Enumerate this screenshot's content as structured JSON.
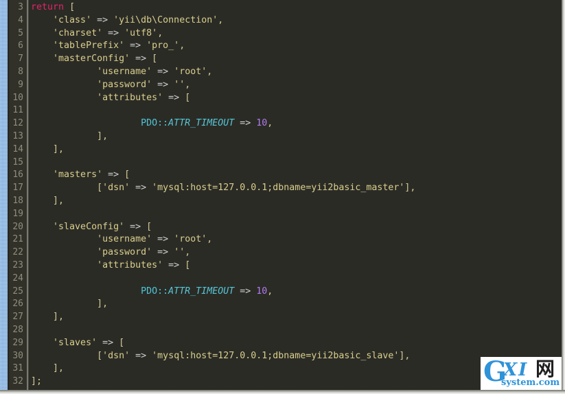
{
  "editor": {
    "theme_name": "dark-monokai",
    "background_color": "#2b2b26",
    "gutter_color": "#313129",
    "marker_rail_color": "#7fb3ea",
    "line_number_color": "#8e8e7e",
    "first_line_number": 3,
    "last_line_number": 32,
    "language": "php"
  },
  "colors": {
    "keyword": "#e2246a",
    "string": "#d9cf8c",
    "operator": "#cfcfcf",
    "class_name": "#4ec6d6",
    "constant": "#55c7d6",
    "number": "#b07cf0",
    "punctuation": "#d4cb96"
  },
  "line_numbers": [
    3,
    4,
    5,
    6,
    7,
    8,
    9,
    10,
    11,
    12,
    13,
    14,
    15,
    16,
    17,
    18,
    19,
    20,
    21,
    22,
    23,
    24,
    25,
    26,
    27,
    28,
    29,
    30,
    31,
    32
  ],
  "code_lines": [
    {
      "number": 3,
      "text": "return [",
      "tokens": [
        {
          "t": "return",
          "c": "t-kw"
        },
        {
          "t": " ",
          "c": "t-plain"
        },
        {
          "t": "[",
          "c": "t-punct"
        }
      ]
    },
    {
      "number": 4,
      "text": "    'class' => 'yii\\db\\Connection',",
      "tokens": [
        {
          "t": "    ",
          "c": "t-plain"
        },
        {
          "t": "'class'",
          "c": "t-str"
        },
        {
          "t": " ",
          "c": "t-plain"
        },
        {
          "t": "=>",
          "c": "t-op"
        },
        {
          "t": " ",
          "c": "t-plain"
        },
        {
          "t": "'yii\\db\\Connection'",
          "c": "t-str"
        },
        {
          "t": ",",
          "c": "t-punct"
        }
      ]
    },
    {
      "number": 5,
      "text": "    'charset' => 'utf8',",
      "tokens": [
        {
          "t": "    ",
          "c": "t-plain"
        },
        {
          "t": "'charset'",
          "c": "t-str"
        },
        {
          "t": " ",
          "c": "t-plain"
        },
        {
          "t": "=>",
          "c": "t-op"
        },
        {
          "t": " ",
          "c": "t-plain"
        },
        {
          "t": "'utf8'",
          "c": "t-str"
        },
        {
          "t": ",",
          "c": "t-punct"
        }
      ]
    },
    {
      "number": 6,
      "text": "    'tablePrefix' => 'pro_',",
      "tokens": [
        {
          "t": "    ",
          "c": "t-plain"
        },
        {
          "t": "'tablePrefix'",
          "c": "t-str"
        },
        {
          "t": " ",
          "c": "t-plain"
        },
        {
          "t": "=>",
          "c": "t-op"
        },
        {
          "t": " ",
          "c": "t-plain"
        },
        {
          "t": "'pro_'",
          "c": "t-str"
        },
        {
          "t": ",",
          "c": "t-punct"
        }
      ]
    },
    {
      "number": 7,
      "text": "    'masterConfig' => [",
      "tokens": [
        {
          "t": "    ",
          "c": "t-plain"
        },
        {
          "t": "'masterConfig'",
          "c": "t-str"
        },
        {
          "t": " ",
          "c": "t-plain"
        },
        {
          "t": "=>",
          "c": "t-op"
        },
        {
          "t": " ",
          "c": "t-plain"
        },
        {
          "t": "[",
          "c": "t-punct"
        }
      ]
    },
    {
      "number": 8,
      "text": "            'username' => 'root',",
      "tokens": [
        {
          "t": "            ",
          "c": "t-plain"
        },
        {
          "t": "'username'",
          "c": "t-str"
        },
        {
          "t": " ",
          "c": "t-plain"
        },
        {
          "t": "=>",
          "c": "t-op"
        },
        {
          "t": " ",
          "c": "t-plain"
        },
        {
          "t": "'root'",
          "c": "t-str"
        },
        {
          "t": ",",
          "c": "t-punct"
        }
      ]
    },
    {
      "number": 9,
      "text": "            'password' => '',",
      "tokens": [
        {
          "t": "            ",
          "c": "t-plain"
        },
        {
          "t": "'password'",
          "c": "t-str"
        },
        {
          "t": " ",
          "c": "t-plain"
        },
        {
          "t": "=>",
          "c": "t-op"
        },
        {
          "t": " ",
          "c": "t-plain"
        },
        {
          "t": "''",
          "c": "t-str"
        },
        {
          "t": ",",
          "c": "t-punct"
        }
      ]
    },
    {
      "number": 10,
      "text": "            'attributes' => [",
      "tokens": [
        {
          "t": "            ",
          "c": "t-plain"
        },
        {
          "t": "'attributes'",
          "c": "t-str"
        },
        {
          "t": " ",
          "c": "t-plain"
        },
        {
          "t": "=>",
          "c": "t-op"
        },
        {
          "t": " ",
          "c": "t-plain"
        },
        {
          "t": "[",
          "c": "t-punct"
        }
      ]
    },
    {
      "number": 11,
      "text": "",
      "tokens": []
    },
    {
      "number": 12,
      "text": "                    PDO::ATTR_TIMEOUT => 10,",
      "tokens": [
        {
          "t": "                    ",
          "c": "t-plain"
        },
        {
          "t": "PDO",
          "c": "t-class"
        },
        {
          "t": "::",
          "c": "t-class"
        },
        {
          "t": "ATTR_TIMEOUT",
          "c": "t-const"
        },
        {
          "t": " ",
          "c": "t-plain"
        },
        {
          "t": "=>",
          "c": "t-op"
        },
        {
          "t": " ",
          "c": "t-plain"
        },
        {
          "t": "10",
          "c": "t-num"
        },
        {
          "t": ",",
          "c": "t-punct"
        }
      ]
    },
    {
      "number": 13,
      "text": "            ],",
      "tokens": [
        {
          "t": "            ",
          "c": "t-plain"
        },
        {
          "t": "],",
          "c": "t-punct"
        }
      ]
    },
    {
      "number": 14,
      "text": "    ],",
      "tokens": [
        {
          "t": "    ",
          "c": "t-plain"
        },
        {
          "t": "],",
          "c": "t-punct"
        }
      ]
    },
    {
      "number": 15,
      "text": "",
      "tokens": []
    },
    {
      "number": 16,
      "text": "    'masters' => [",
      "tokens": [
        {
          "t": "    ",
          "c": "t-plain"
        },
        {
          "t": "'masters'",
          "c": "t-str"
        },
        {
          "t": " ",
          "c": "t-plain"
        },
        {
          "t": "=>",
          "c": "t-op"
        },
        {
          "t": " ",
          "c": "t-plain"
        },
        {
          "t": "[",
          "c": "t-punct"
        }
      ]
    },
    {
      "number": 17,
      "text": "            ['dsn' => 'mysql:host=127.0.0.1;dbname=yii2basic_master'],",
      "tokens": [
        {
          "t": "            ",
          "c": "t-plain"
        },
        {
          "t": "[",
          "c": "t-punct"
        },
        {
          "t": "'dsn'",
          "c": "t-str"
        },
        {
          "t": " ",
          "c": "t-plain"
        },
        {
          "t": "=>",
          "c": "t-op"
        },
        {
          "t": " ",
          "c": "t-plain"
        },
        {
          "t": "'mysql:host=127.0.0.1;dbname=yii2basic_master'",
          "c": "t-str"
        },
        {
          "t": "],",
          "c": "t-punct"
        }
      ]
    },
    {
      "number": 18,
      "text": "    ],",
      "tokens": [
        {
          "t": "    ",
          "c": "t-plain"
        },
        {
          "t": "],",
          "c": "t-punct"
        }
      ]
    },
    {
      "number": 19,
      "text": "",
      "tokens": []
    },
    {
      "number": 20,
      "text": "    'slaveConfig' => [",
      "tokens": [
        {
          "t": "    ",
          "c": "t-plain"
        },
        {
          "t": "'slaveConfig'",
          "c": "t-str"
        },
        {
          "t": " ",
          "c": "t-plain"
        },
        {
          "t": "=>",
          "c": "t-op"
        },
        {
          "t": " ",
          "c": "t-plain"
        },
        {
          "t": "[",
          "c": "t-punct"
        }
      ]
    },
    {
      "number": 21,
      "text": "            'username' => 'root',",
      "tokens": [
        {
          "t": "            ",
          "c": "t-plain"
        },
        {
          "t": "'username'",
          "c": "t-str"
        },
        {
          "t": " ",
          "c": "t-plain"
        },
        {
          "t": "=>",
          "c": "t-op"
        },
        {
          "t": " ",
          "c": "t-plain"
        },
        {
          "t": "'root'",
          "c": "t-str"
        },
        {
          "t": ",",
          "c": "t-punct"
        }
      ]
    },
    {
      "number": 22,
      "text": "            'password' => '',",
      "tokens": [
        {
          "t": "            ",
          "c": "t-plain"
        },
        {
          "t": "'password'",
          "c": "t-str"
        },
        {
          "t": " ",
          "c": "t-plain"
        },
        {
          "t": "=>",
          "c": "t-op"
        },
        {
          "t": " ",
          "c": "t-plain"
        },
        {
          "t": "''",
          "c": "t-str"
        },
        {
          "t": ",",
          "c": "t-punct"
        }
      ]
    },
    {
      "number": 23,
      "text": "            'attributes' => [",
      "tokens": [
        {
          "t": "            ",
          "c": "t-plain"
        },
        {
          "t": "'attributes'",
          "c": "t-str"
        },
        {
          "t": " ",
          "c": "t-plain"
        },
        {
          "t": "=>",
          "c": "t-op"
        },
        {
          "t": " ",
          "c": "t-plain"
        },
        {
          "t": "[",
          "c": "t-punct"
        }
      ]
    },
    {
      "number": 24,
      "text": "",
      "tokens": []
    },
    {
      "number": 25,
      "text": "                    PDO::ATTR_TIMEOUT => 10,",
      "tokens": [
        {
          "t": "                    ",
          "c": "t-plain"
        },
        {
          "t": "PDO",
          "c": "t-class"
        },
        {
          "t": "::",
          "c": "t-class"
        },
        {
          "t": "ATTR_TIMEOUT",
          "c": "t-const"
        },
        {
          "t": " ",
          "c": "t-plain"
        },
        {
          "t": "=>",
          "c": "t-op"
        },
        {
          "t": " ",
          "c": "t-plain"
        },
        {
          "t": "10",
          "c": "t-num"
        },
        {
          "t": ",",
          "c": "t-punct"
        }
      ]
    },
    {
      "number": 26,
      "text": "            ],",
      "tokens": [
        {
          "t": "            ",
          "c": "t-plain"
        },
        {
          "t": "],",
          "c": "t-punct"
        }
      ]
    },
    {
      "number": 27,
      "text": "    ],",
      "tokens": [
        {
          "t": "    ",
          "c": "t-plain"
        },
        {
          "t": "],",
          "c": "t-punct"
        }
      ]
    },
    {
      "number": 28,
      "text": "",
      "tokens": []
    },
    {
      "number": 29,
      "text": "    'slaves' => [",
      "tokens": [
        {
          "t": "    ",
          "c": "t-plain"
        },
        {
          "t": "'slaves'",
          "c": "t-str"
        },
        {
          "t": " ",
          "c": "t-plain"
        },
        {
          "t": "=>",
          "c": "t-op"
        },
        {
          "t": " ",
          "c": "t-plain"
        },
        {
          "t": "[",
          "c": "t-punct"
        }
      ]
    },
    {
      "number": 30,
      "text": "            ['dsn' => 'mysql:host=127.0.0.1;dbname=yii2basic_slave'],",
      "tokens": [
        {
          "t": "            ",
          "c": "t-plain"
        },
        {
          "t": "[",
          "c": "t-punct"
        },
        {
          "t": "'dsn'",
          "c": "t-str"
        },
        {
          "t": " ",
          "c": "t-plain"
        },
        {
          "t": "=>",
          "c": "t-op"
        },
        {
          "t": " ",
          "c": "t-plain"
        },
        {
          "t": "'mysql:host=127.0.0.1;dbname=yii2basic_slave'",
          "c": "t-str"
        },
        {
          "t": "],",
          "c": "t-punct"
        }
      ]
    },
    {
      "number": 31,
      "text": "    ],",
      "tokens": [
        {
          "t": "    ",
          "c": "t-plain"
        },
        {
          "t": "],",
          "c": "t-punct"
        }
      ]
    },
    {
      "number": 32,
      "text": "];",
      "tokens": [
        {
          "t": "];",
          "c": "t-punct"
        }
      ]
    }
  ],
  "watermark": {
    "letter_g": "G",
    "letters_xi": "XI",
    "char_cn": "网",
    "subtitle": "system.com",
    "brand_color": "#2f93d9"
  }
}
